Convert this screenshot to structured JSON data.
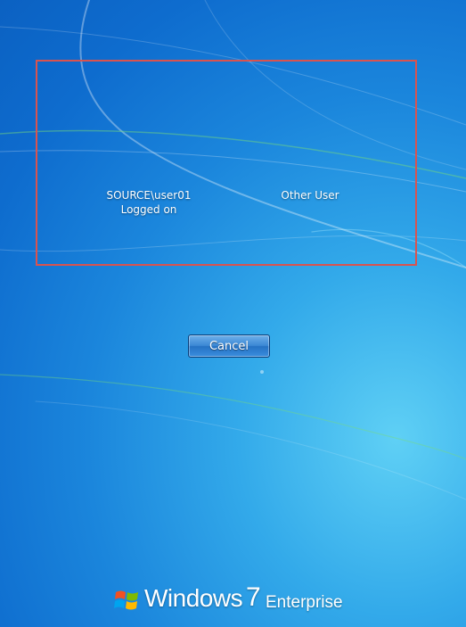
{
  "users": [
    {
      "name": "SOURCE\\user01",
      "status": "Logged on"
    },
    {
      "name": "Other User",
      "status": ""
    }
  ],
  "actions": {
    "cancel_label": "Cancel"
  },
  "branding": {
    "brand_word": "Windows",
    "version": "7",
    "edition": "Enterprise",
    "logo": "windows-flag-icon"
  },
  "colors": {
    "background": "#1b86dc",
    "highlight_border": "#d9534f",
    "text": "#ffffff"
  }
}
